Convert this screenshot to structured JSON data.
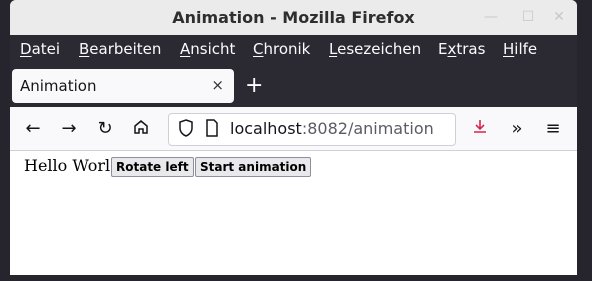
{
  "window": {
    "title": "Animation - Mozilla Firefox",
    "controls": [
      "minimize",
      "maximize",
      "close"
    ]
  },
  "menubar": {
    "items": [
      {
        "underline": "D",
        "rest": "atei"
      },
      {
        "underline": "B",
        "rest": "earbeiten"
      },
      {
        "underline": "A",
        "rest": "nsicht"
      },
      {
        "underline": "C",
        "rest": "hronik"
      },
      {
        "underline": "L",
        "rest": "esezeichen"
      },
      {
        "underline": "E",
        "rest": "xtras",
        "pre": "E"
      },
      {
        "underline": "H",
        "rest": "ilfe"
      }
    ]
  },
  "tabs": {
    "active_label": "Animation",
    "close_glyph": "×",
    "new_tab_glyph": "+"
  },
  "navbar": {
    "url_host": "localhost",
    "url_rest": ":8082/animation"
  },
  "page": {
    "text": "Hello World!",
    "rotate_button": "Rotate left",
    "start_button": "Start animation"
  }
}
